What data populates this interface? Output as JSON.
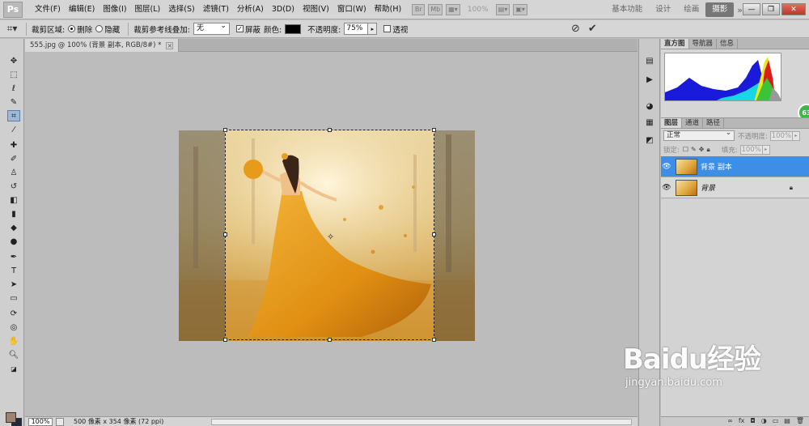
{
  "app": {
    "logo": "Ps",
    "menu": [
      "文件(F)",
      "编辑(E)",
      "图像(I)",
      "图层(L)",
      "选择(S)",
      "滤镜(T)",
      "分析(A)",
      "3D(D)",
      "视图(V)",
      "窗口(W)",
      "帮助(H)"
    ],
    "menubar_tools": {
      "br_label": "Br",
      "mb_label": "Mb",
      "zoom_value": "100%"
    },
    "workspaces": [
      "基本功能",
      "设计",
      "绘画",
      "摄影"
    ],
    "workspace_more": "»",
    "window_controls": {
      "minimize": "—",
      "restore": "❐",
      "close": "✕"
    }
  },
  "options_bar": {
    "crop_area_label": "裁剪区域:",
    "delete_label": "删除",
    "hide_label": "隐藏",
    "overlay_label": "裁剪参考线叠加:",
    "overlay_value": "无",
    "shield_label": "屏蔽",
    "color_label": "颜色:",
    "shield_color": "#000000",
    "opacity_label": "不透明度:",
    "opacity_value": "75%",
    "perspective_label": "透视",
    "cancel_icon": "⊘",
    "commit_icon": "✔"
  },
  "document": {
    "tab_title": "555.jpg @ 100% (背景 副本, RGB/8#) *",
    "tab_close": "×"
  },
  "status_bar": {
    "zoom": "100%",
    "info": "500 像素 x 354 像素 (72 ppi)"
  },
  "panels": {
    "top_tabs": [
      "直方图",
      "导航器",
      "信息"
    ],
    "layer_tabs": [
      "图层",
      "通道",
      "路径"
    ],
    "blend_mode": "正常",
    "opacity_label": "不透明度:",
    "opacity_value": "100%",
    "lock_label": "锁定:",
    "fill_label": "填充:",
    "fill_value": "100%",
    "badge": "63",
    "layers": [
      {
        "name": "背景 副本",
        "selected": true
      },
      {
        "name": "背景",
        "selected": false,
        "locked": true
      }
    ],
    "footer_icons": [
      "∞",
      "fx",
      "◘",
      "◑",
      "▭",
      "▤",
      "🗑"
    ]
  },
  "watermark": {
    "logo": "Baidu经验",
    "url": "jingyan.baidu.com"
  }
}
